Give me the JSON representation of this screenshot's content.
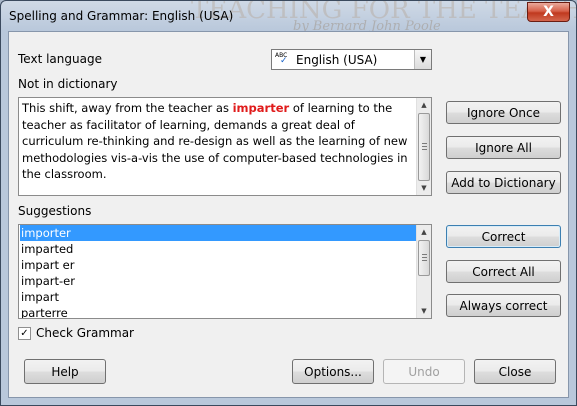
{
  "window": {
    "title": "Spelling and Grammar: English (USA)",
    "close_symbol": "X",
    "background_heading": "TEACHING FOR THE TEACH",
    "background_byline": "by Bernard John Poole"
  },
  "language": {
    "label": "Text language",
    "selected": "English (USA)",
    "icon": "spellcheck-abc-icon"
  },
  "not_in_dictionary": {
    "label": "Not in dictionary",
    "text_before": "This shift, away from the teacher as ",
    "error_word": "imparter",
    "text_after": " of learning to the teacher as facilitator of learning, demands a great deal of curriculum re-thinking and re-design as well as the learning of new methodologies vis-a-vis the use of computer-based technologies in the classroom."
  },
  "suggestions": {
    "label": "Suggestions",
    "items": [
      "importer",
      "imparted",
      "impart er",
      "impart-er",
      "impart",
      "parterre"
    ],
    "selected_index": 0
  },
  "check_grammar": {
    "label": "Check Grammar",
    "checked": true
  },
  "buttons": {
    "ignore_once": "Ignore Once",
    "ignore_all": "Ignore All",
    "add_to_dictionary": "Add to Dictionary",
    "correct": "Correct",
    "correct_all": "Correct All",
    "always_correct": "Always correct",
    "help": "Help",
    "options": "Options...",
    "undo": "Undo",
    "close": "Close"
  },
  "colors": {
    "error_word": "#e01b1b",
    "selection": "#3399ff",
    "close_button": "#c0391f"
  }
}
